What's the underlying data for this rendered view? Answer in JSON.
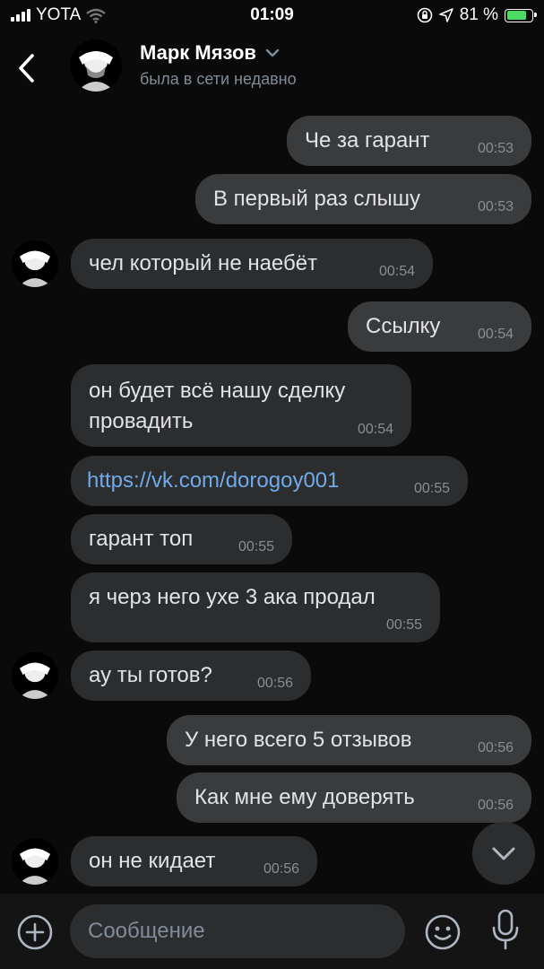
{
  "status_bar": {
    "carrier": "YOTA",
    "time": "01:09",
    "battery_percent": "81 %",
    "battery_level": 0.81
  },
  "header": {
    "contact_name": "Марк Мязов",
    "status": "была в сети недавно"
  },
  "messages": [
    {
      "dir": "out",
      "text": "Че за гарант",
      "time": "00:53"
    },
    {
      "dir": "out",
      "text": "В первый раз слышу",
      "time": "00:53"
    },
    {
      "dir": "in",
      "text": "чел который не наебёт",
      "time": "00:54"
    },
    {
      "dir": "out",
      "text": "Ссылку",
      "time": "00:54"
    },
    {
      "dir": "in",
      "text_line1": "он будет всё нашу сделку",
      "text_line2": "провадить",
      "time": "00:54"
    },
    {
      "dir": "in",
      "text": "https://vk.com/dorogoy001",
      "time": "00:55"
    },
    {
      "dir": "in",
      "text": "гарант топ",
      "time": "00:55"
    },
    {
      "dir": "in",
      "text": "я черз него ухе 3 ака продал",
      "time": "00:55"
    },
    {
      "dir": "in",
      "text": "ау ты готов?",
      "time": "00:56"
    },
    {
      "dir": "out",
      "text": "У него всего 5 отзывов",
      "time": "00:56"
    },
    {
      "dir": "out",
      "text": "Как мне ему доверять",
      "time": "00:56"
    },
    {
      "dir": "in",
      "text": "он не кидает",
      "time": "00:56"
    }
  ],
  "composer": {
    "placeholder": "Сообщение"
  },
  "icons": {
    "back": "chevron-left-icon",
    "name_dropdown": "chevron-down-icon",
    "scroll_down": "chevron-down-icon",
    "attach": "plus-circle-icon",
    "emoji": "smile-icon",
    "voice": "microphone-icon"
  },
  "colors": {
    "link": "#71aaeb",
    "battery": "#4cd964",
    "bubble_in": "#2c2d2e",
    "bubble_out": "#3a3b3c"
  }
}
